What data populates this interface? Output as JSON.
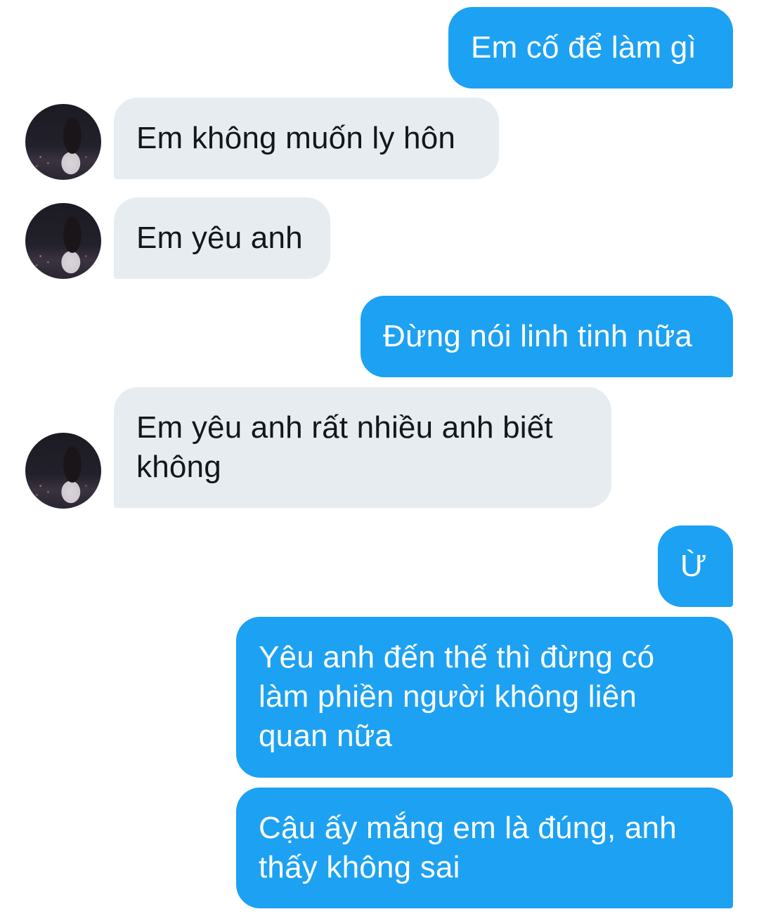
{
  "conversation": {
    "messages": [
      {
        "sender": "outgoing",
        "text": "Em cố để làm gì"
      },
      {
        "sender": "incoming",
        "text": "Em không muốn ly hôn"
      },
      {
        "sender": "incoming",
        "text": "Em yêu anh"
      },
      {
        "sender": "outgoing",
        "text": "Đừng nói linh tinh nữa"
      },
      {
        "sender": "incoming",
        "text": "Em yêu anh rất nhiều anh biết\nkhông"
      },
      {
        "sender": "outgoing",
        "text": "Ừ"
      },
      {
        "sender": "outgoing",
        "text": "Yêu anh đến thế thì đừng có\nlàm phiền người không liên\nquan nữa"
      },
      {
        "sender": "outgoing",
        "text": "Cậu ấy mắng em là đúng, anh\nthấy không sai"
      }
    ]
  },
  "colors": {
    "outgoing_bubble": "#1da1f2",
    "incoming_bubble": "#e6ecf0",
    "outgoing_text": "#ffffff",
    "incoming_text": "#14171a"
  }
}
